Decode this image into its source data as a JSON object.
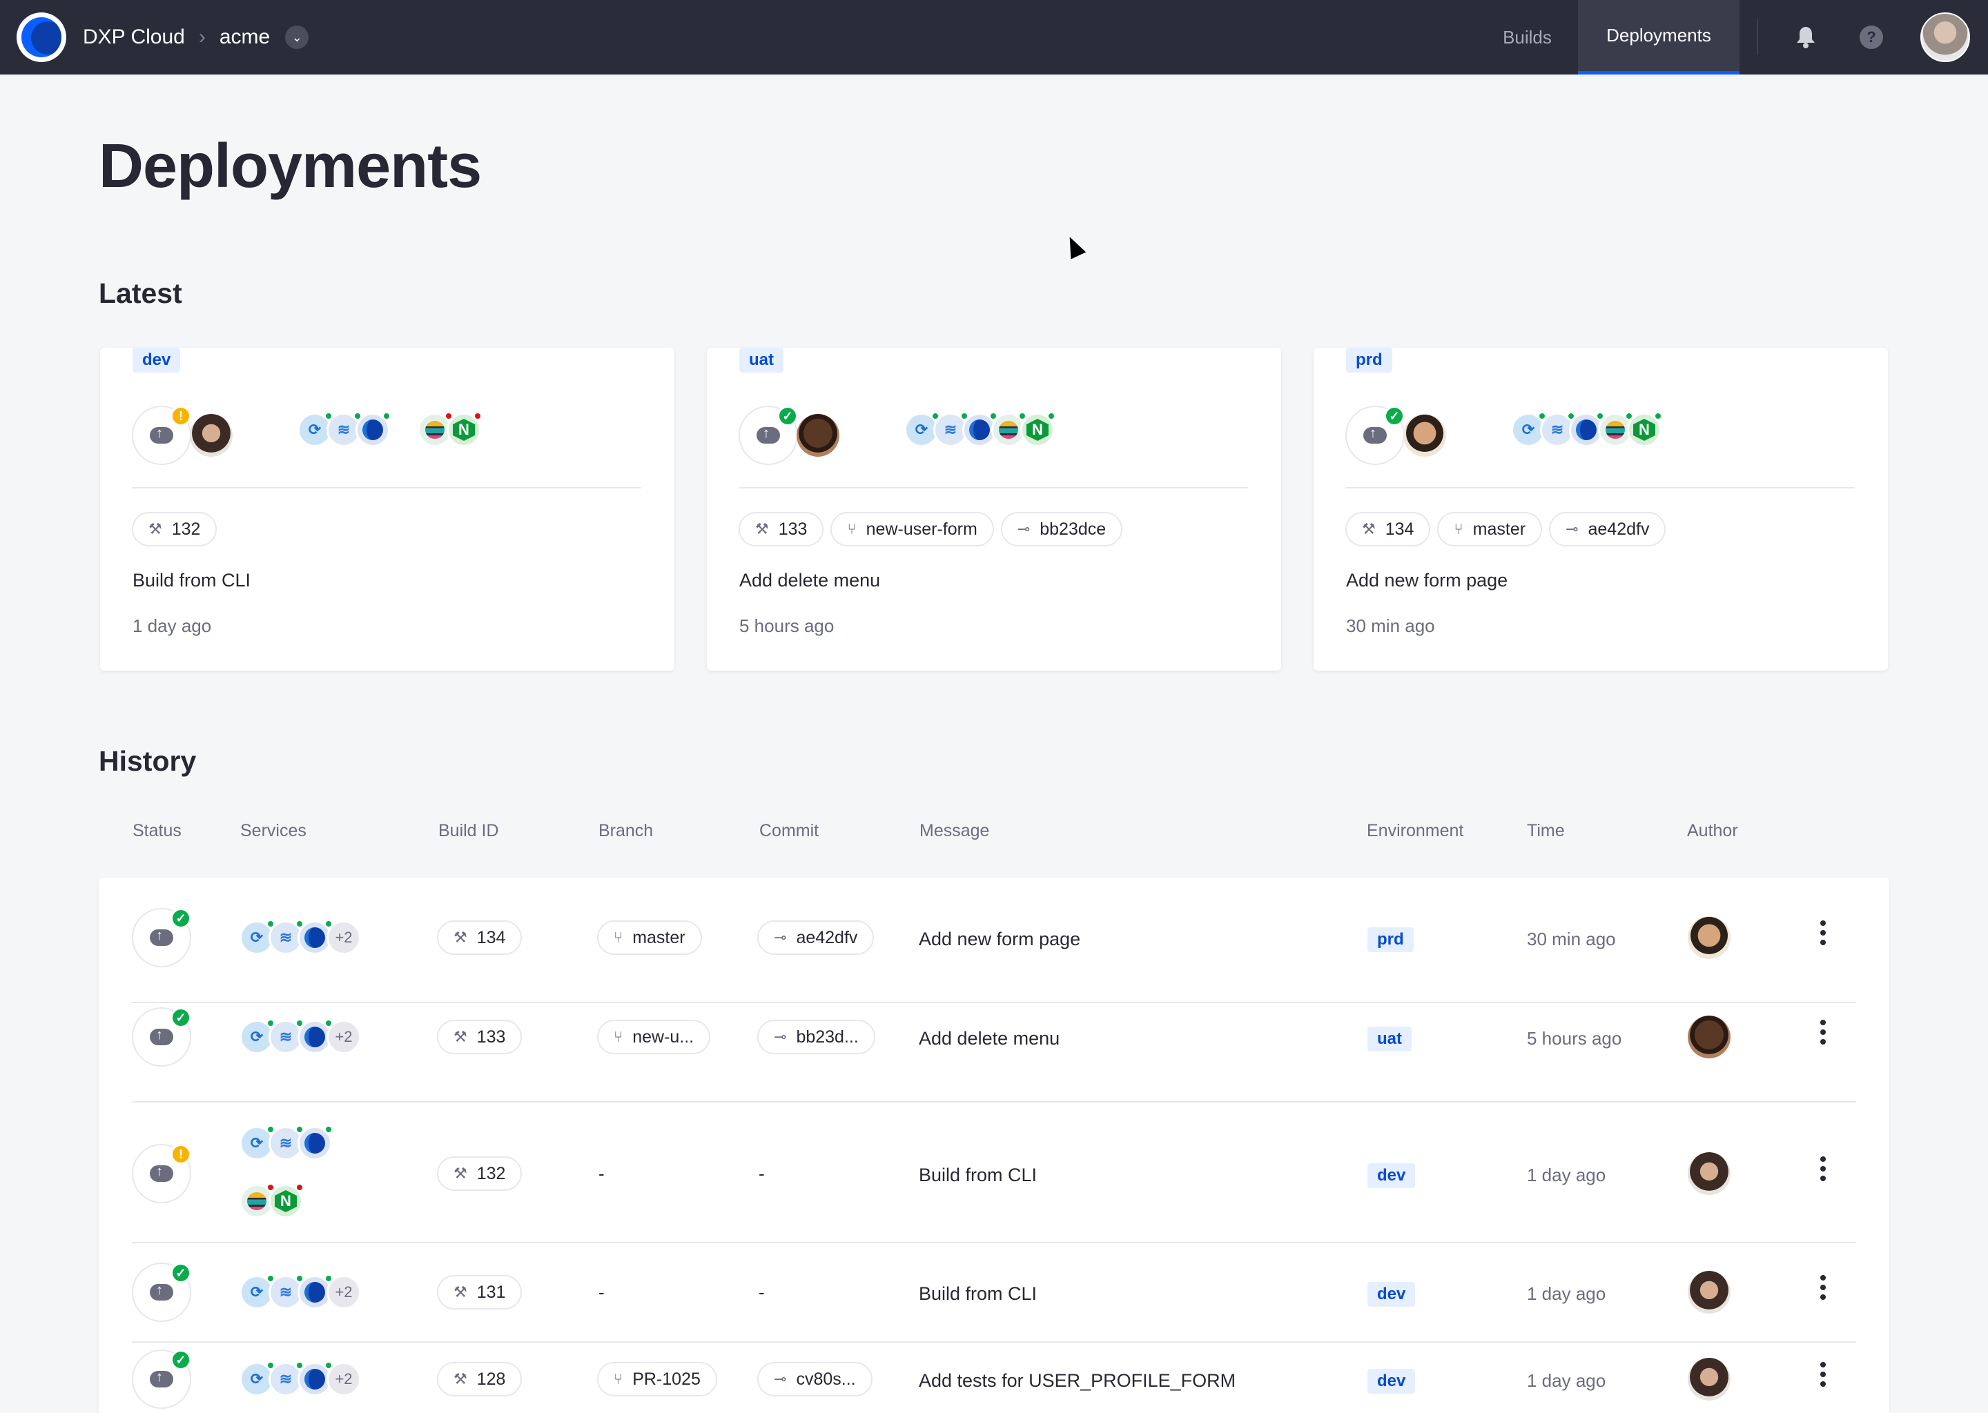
{
  "topbar": {
    "brand": "DXP Cloud",
    "project": "acme",
    "nav": [
      "Builds",
      "Deployments"
    ],
    "active_nav": "Deployments",
    "help_glyph": "?"
  },
  "page_title": "Deployments",
  "latest": {
    "heading": "Latest",
    "cards": [
      {
        "env": "dev",
        "status": "warning",
        "build": "132",
        "branch": "",
        "commit": "",
        "message": "Build from CLI",
        "time": "1 day ago"
      },
      {
        "env": "uat",
        "status": "success",
        "build": "133",
        "branch": "new-user-form",
        "commit": "bb23dce",
        "message": "Add delete menu",
        "time": "5 hours ago"
      },
      {
        "env": "prd",
        "status": "success",
        "build": "134",
        "branch": "master",
        "commit": "ae42dfv",
        "message": "Add new form page",
        "time": "30 min ago"
      }
    ]
  },
  "history": {
    "heading": "History",
    "columns": [
      "Status",
      "Services",
      "Build ID",
      "Branch",
      "Commit",
      "Message",
      "Environment",
      "Time",
      "Author"
    ],
    "more_services": "+2",
    "dash": "-",
    "rows": [
      {
        "status": "success",
        "build": "134",
        "branch": "master",
        "commit": "ae42dfv",
        "message": "Add new form page",
        "env": "prd",
        "time": "30 min ago"
      },
      {
        "status": "success",
        "build": "133",
        "branch": "new-u...",
        "commit": "bb23d...",
        "message": "Add delete menu",
        "env": "uat",
        "time": "5 hours ago"
      },
      {
        "status": "warning",
        "build": "132",
        "branch": "-",
        "commit": "-",
        "message": "Build from CLI",
        "env": "dev",
        "time": "1 day ago"
      },
      {
        "status": "success",
        "build": "131",
        "branch": "-",
        "commit": "-",
        "message": "Build from CLI",
        "env": "dev",
        "time": "1 day ago"
      },
      {
        "status": "success",
        "build": "128",
        "branch": "PR-1025",
        "commit": "cv80s...",
        "message": "Add tests for USER_PROFILE_FORM",
        "env": "dev",
        "time": "1 day ago"
      }
    ]
  },
  "icons": {
    "status_success": "check-icon",
    "status_warning": "exclamation-icon",
    "build": "hammer-icon",
    "branch": "branch-icon",
    "commit": "commit-icon"
  },
  "colors": {
    "topbar": "#2a2d39",
    "accent": "#0b5fff",
    "success": "#0aab4b",
    "warning": "#fbb200",
    "error": "#da1414"
  }
}
